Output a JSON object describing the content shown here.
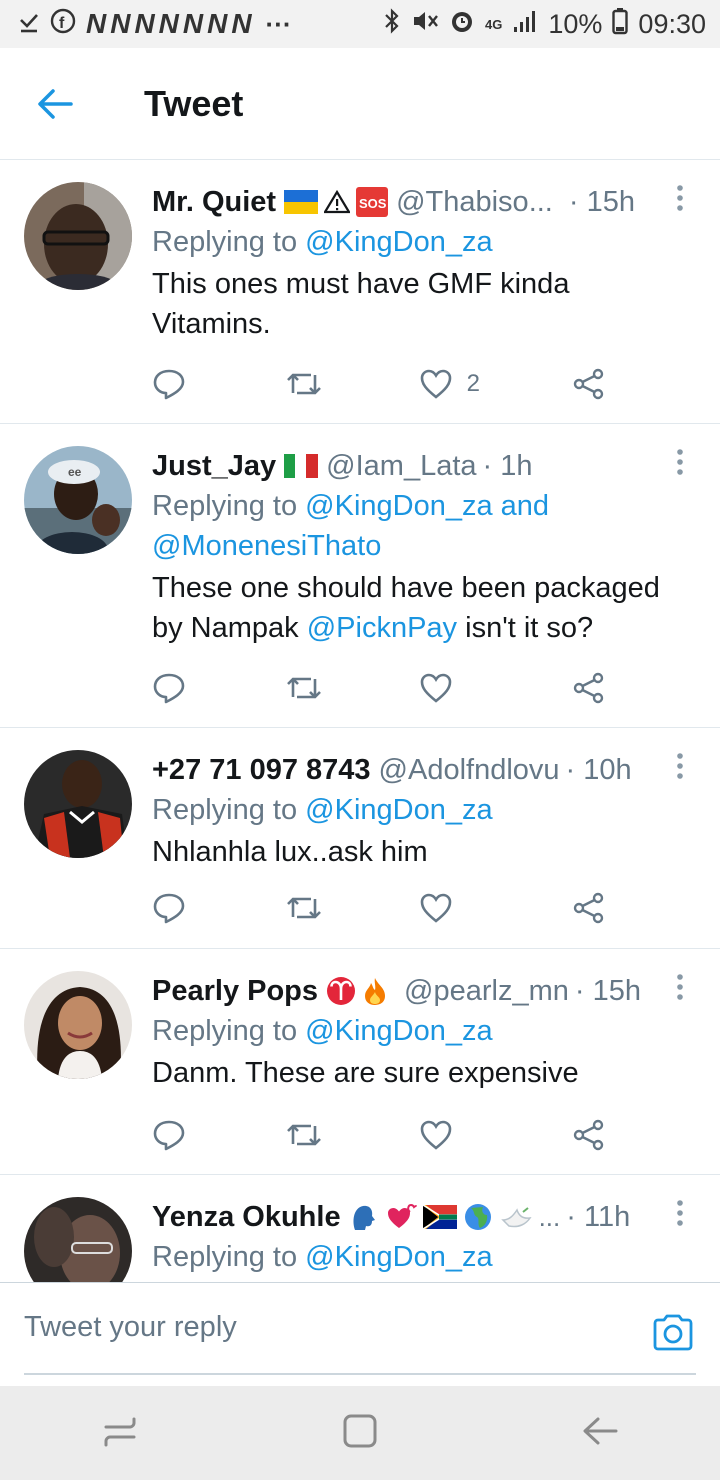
{
  "status_bar": {
    "notification_letters": "NNNNNNN",
    "dots": "···",
    "network": "4G",
    "battery": "10%",
    "time": "09:30"
  },
  "header": {
    "title": "Tweet"
  },
  "replies": [
    {
      "name": "Mr. Quiet",
      "emoji": "🇺🇦 ⚠ 🆘",
      "handle": "@Thabiso...",
      "time": "· 15h",
      "replying_prefix": "Replying to ",
      "replying_to": "@KingDon_za",
      "replying_extra": "",
      "text_lines": [
        "This ones must have GMF kinda",
        "Vitamins."
      ],
      "like_count": "2"
    },
    {
      "name": "Just_Jay",
      "emoji": "🇮🇹",
      "handle": "@Iam_Lata",
      "time": "· 1h",
      "replying_prefix": "Replying to ",
      "replying_to": "@KingDon_za and",
      "replying_extra": "@MonenesiThato",
      "text_lines": [
        "These one should have been packaged"
      ],
      "text_line2_prefix": "by Nampak ",
      "text_line2_link": "@PicknPay",
      "text_line2_suffix": " isn't it so?",
      "like_count": ""
    },
    {
      "name": "+27 71 097 8743",
      "emoji": "",
      "handle": "@Adolfndlovu",
      "time": "· 10h",
      "replying_prefix": "Replying to ",
      "replying_to": "@KingDon_za",
      "replying_extra": "",
      "text_lines": [
        "Nhlanhla lux..ask him"
      ],
      "like_count": ""
    },
    {
      "name": "Pearly Pops",
      "emoji": "♈ 🔥",
      "handle": "@pearlz_mn",
      "time": "· 15h",
      "replying_prefix": "Replying to ",
      "replying_to": "@KingDon_za",
      "replying_extra": "",
      "text_lines": [
        "Danm. These are sure expensive"
      ],
      "like_count": ""
    },
    {
      "name": "Yenza Okuhle",
      "emoji": "🗣 💞 🇿🇦 🌍 🕊 ...",
      "handle": "",
      "time": "· 11h",
      "replying_prefix": "Replying to ",
      "replying_to": "@KingDon_za",
      "replying_extra": "",
      "text_lines": [],
      "like_count": ""
    }
  ],
  "composer": {
    "placeholder": "Tweet your reply"
  },
  "colors": {
    "accent": "#1b95e0",
    "muted": "#657786",
    "text": "#14171a",
    "divider": "#e1e8ed"
  }
}
